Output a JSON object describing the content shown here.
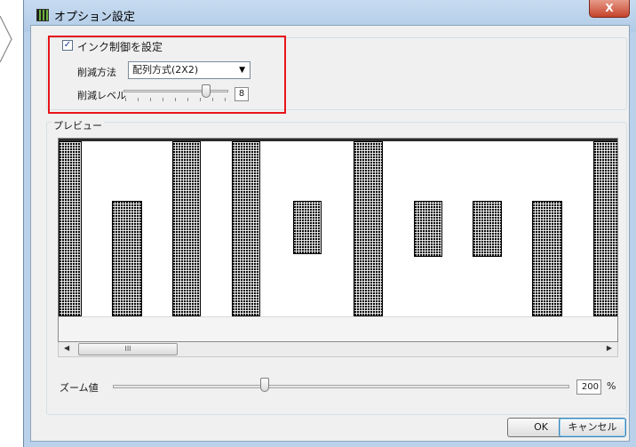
{
  "window": {
    "title": "オプション設定",
    "close_symbol": "X"
  },
  "ink_control": {
    "checkbox_label": "インク制御を設定",
    "checked": true,
    "checkmark": "✓",
    "method_label": "削減方法",
    "method_value": "配列方式(2X2)",
    "level_label": "削減レベル",
    "level_value": "8",
    "level_fraction": 0.8
  },
  "preview": {
    "label": "プレビュー",
    "scroll_thumb_grip": "III",
    "scroll_left": "◀",
    "scroll_right": "▶"
  },
  "zoom": {
    "label": "ズーム値",
    "value": "200",
    "unit": "%",
    "fraction": 0.33
  },
  "buttons": {
    "ok": "OK",
    "cancel": "キャンセル"
  },
  "colors": {
    "highlight_box": "#e8141b",
    "title_bar": "#b9d1ea",
    "dialog_bg": "#f0f0f0"
  },
  "icons": [
    "app-icon",
    "close-icon",
    "combo-arrow-icon",
    "scroll-left-icon",
    "scroll-right-icon"
  ]
}
